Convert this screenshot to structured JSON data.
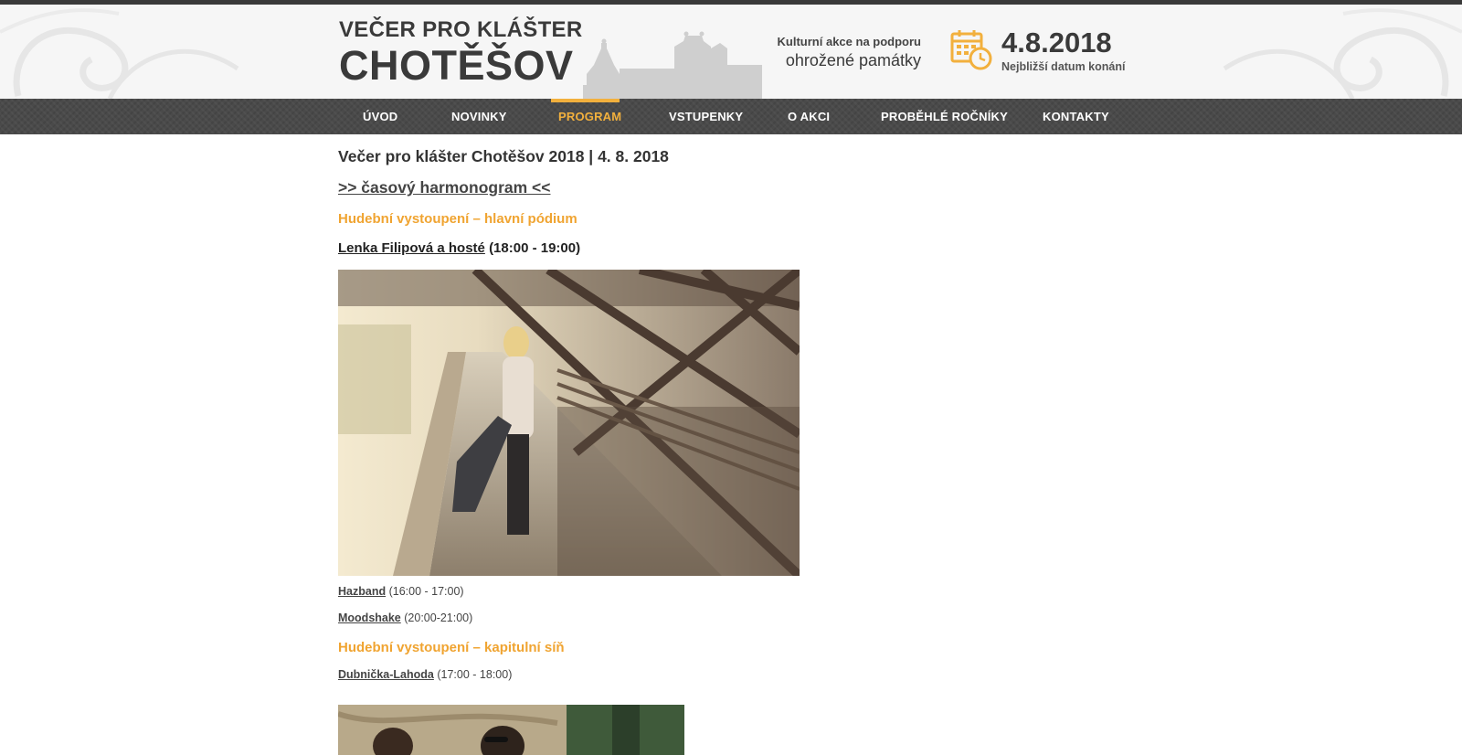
{
  "header": {
    "logo_line1": "VEČER PRO KLÁŠTER",
    "logo_line2": "CHOTĚŠOV",
    "tagline_line1": "Kulturní akce na podporu",
    "tagline_line2": "ohrožené památky",
    "date": "4.8.2018",
    "date_caption": "Nejbližší datum konání"
  },
  "nav": {
    "items": [
      {
        "label": "ÚVOD"
      },
      {
        "label": "NOVINKY"
      },
      {
        "label": "PROGRAM"
      },
      {
        "label": "VSTUPENKY"
      },
      {
        "label": "O AKCI"
      },
      {
        "label": "PROBĚHLÉ ROČNÍKY"
      },
      {
        "label": "KONTAKTY"
      }
    ],
    "active": "PROGRAM"
  },
  "main": {
    "title": "Večer pro klášter Chotěšov 2018 | 4. 8. 2018",
    "harmonogram_link": ">> časový harmonogram <<",
    "section1": "Hudební vystoupení – hlavní pódium",
    "featured": {
      "name": "Lenka Filipová a hosté",
      "time": "(18:00 - 19:00)"
    },
    "main_stage": [
      {
        "name": "Hazband",
        "time": "(16:00 - 17:00)"
      },
      {
        "name": "Moodshake",
        "time": "(20:00-21:00)"
      }
    ],
    "section2": "Hudební vystoupení – kapitulní síň",
    "chapter_hall": [
      {
        "name": "Dubnička-Lahoda",
        "time": "(17:00 - 18:00)"
      }
    ]
  },
  "colors": {
    "accent": "#f2b03d",
    "section_heading": "#f0a431",
    "nav_bg": "#4a4a4a",
    "text_dark": "#333333"
  },
  "icons": {
    "calendar": "calendar-clock-icon"
  }
}
